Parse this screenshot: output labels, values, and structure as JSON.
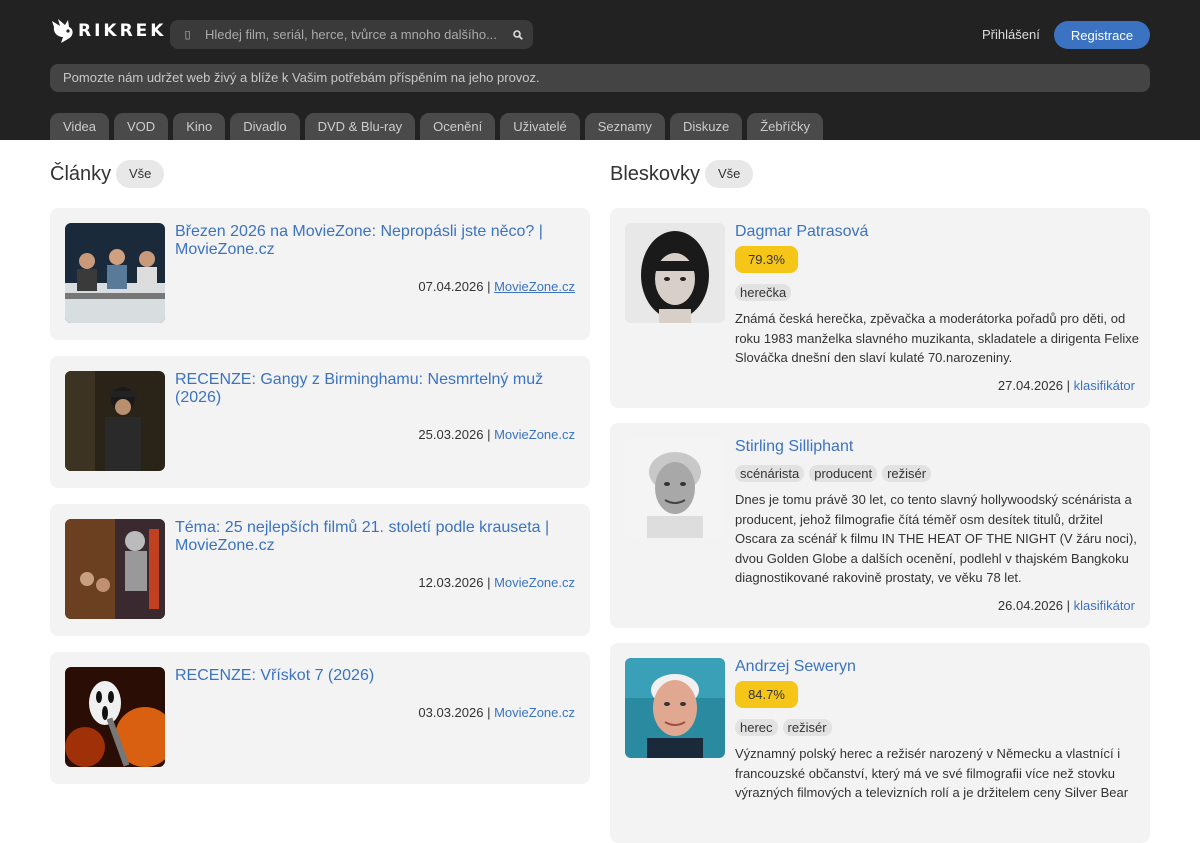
{
  "header": {
    "logo_text": "RIKREK",
    "search_placeholder": "Hledej film, seriál, herce, tvůrce a mnoho dalšího...",
    "login_label": "Přihlášení",
    "register_label": "Registrace",
    "notice": "Pomozte nám udržet web živý a blíže k Vašim potřebám příspěním na jeho provoz."
  },
  "nav": [
    "Videa",
    "VOD",
    "Kino",
    "Divadlo",
    "DVD & Blu-ray",
    "Ocenění",
    "Uživatelé",
    "Seznamy",
    "Diskuze",
    "Žebříčky"
  ],
  "articles": {
    "title": "Články",
    "all_label": "Vše",
    "items": [
      {
        "title": "Březen 2026 na MovieZone: Nepropásli jste něco? | MovieZone.cz",
        "date": "07.04.2026 |",
        "source": "MovieZone.cz"
      },
      {
        "title": "RECENZE: Gangy z Birminghamu: Nesmrtelný muž (2026)",
        "date": "25.03.2026 |",
        "source": "MovieZone.cz"
      },
      {
        "title": "Téma: 25 nejlepších filmů 21. století podle krauseta | MovieZone.cz",
        "date": "12.03.2026 |",
        "source": "MovieZone.cz"
      },
      {
        "title": "RECENZE: Vřískot 7 (2026)",
        "date": "03.03.2026 |",
        "source": "MovieZone.cz"
      }
    ]
  },
  "news": {
    "title": "Bleskovky",
    "all_label": "Vše",
    "items": [
      {
        "name": "Dagmar Patrasová",
        "score": "79.3%",
        "tags": [
          "herečka"
        ],
        "text": "Známá česká herečka, zpěvačka a moderátorka pořadů pro děti, od roku 1983 manželka slavného muzikanta, skladatele a dirigenta Felixe Slováčka dnešní den slaví kulaté 70.narozeniny.",
        "date": "27.04.2026 |",
        "source": "klasifikátor"
      },
      {
        "name": "Stirling Silliphant",
        "tags": [
          "scénárista",
          "producent",
          "režisér"
        ],
        "text": "Dnes je tomu právě 30 let, co tento slavný hollywoodský scénárista a producent, jehož filmografie čítá téměř osm desítek titulů, držitel Oscara za scénář k filmu IN THE HEAT OF THE NIGHT (V žáru noci), dvou Golden Globe a dalších ocenění, podlehl v thajském Bangkoku diagnostikované rakovině prostaty, ve věku 78 let.",
        "date": "26.04.2026 |",
        "source": "klasifikátor"
      },
      {
        "name": "Andrzej Seweryn",
        "score": "84.7%",
        "tags": [
          "herec",
          "režisér"
        ],
        "text": "Významný polský herec a režisér narozený v Německu a vlastnící i francouzské občanství, který má ve své filmografii více než stovku výrazných filmových a televizních rolí a je držitelem ceny Silver Bear"
      }
    ]
  }
}
